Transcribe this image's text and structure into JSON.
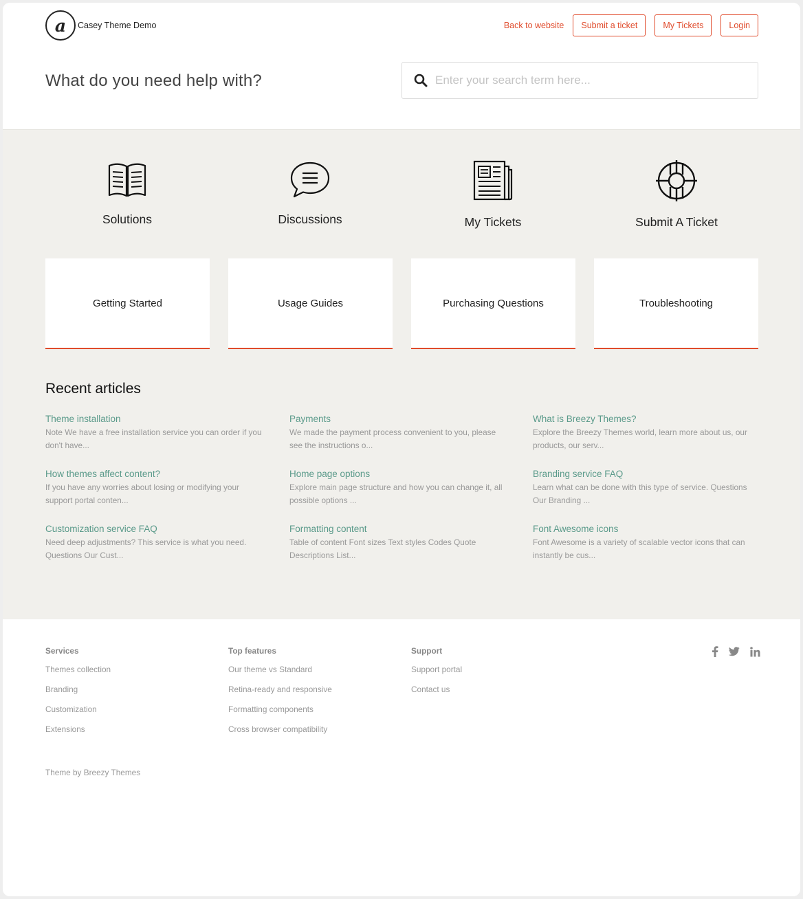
{
  "header": {
    "brand_mark": "a",
    "brand_name": "Casey Theme Demo",
    "nav": {
      "back_link": "Back to website",
      "submit_ticket": "Submit a ticket",
      "my_tickets": "My Tickets",
      "login": "Login"
    }
  },
  "hero": {
    "title": "What do you need help with?",
    "search_placeholder": "Enter your search term here..."
  },
  "quick_links": [
    {
      "label": "Solutions",
      "icon": "open-book-icon"
    },
    {
      "label": "Discussions",
      "icon": "speech-bubble-icon"
    },
    {
      "label": "My Tickets",
      "icon": "newspaper-icon"
    },
    {
      "label": "Submit A Ticket",
      "icon": "lifebuoy-icon"
    }
  ],
  "categories": [
    {
      "label": "Getting Started"
    },
    {
      "label": "Usage Guides"
    },
    {
      "label": "Purchasing Questions"
    },
    {
      "label": "Troubleshooting"
    }
  ],
  "recent": {
    "title": "Recent articles",
    "articles": [
      {
        "title": "Theme installation",
        "desc": "  Note We have a free installation service you can order if you don't have..."
      },
      {
        "title": "Payments",
        "desc": "We made the payment process convenient to you, please see the instructions o..."
      },
      {
        "title": "What is Breezy Themes?",
        "desc": "Explore the Breezy Themes world, learn more about us, our products, our serv..."
      },
      {
        "title": "How themes affect content?",
        "desc": "If you have any worries about losing or modifying your support portal conten..."
      },
      {
        "title": "Home page options",
        "desc": "Explore main page structure and how you can change it, all possible options ..."
      },
      {
        "title": "Branding service FAQ",
        "desc": "Learn what can be done with this type of service. Questions  Our Branding ..."
      },
      {
        "title": "Customization service FAQ",
        "desc": "Need deep adjustments? This service is what you need. Questions Our Cust..."
      },
      {
        "title": "Formatting content",
        "desc": "Table of content Font sizes Text styles Codes Quote Descriptions List..."
      },
      {
        "title": "Font Awesome icons",
        "desc": "Font Awesome is a variety of scalable vector icons that can instantly be cus..."
      }
    ]
  },
  "footer": {
    "columns": [
      {
        "heading": "Services",
        "links": [
          "Themes collection",
          "Branding",
          "Customization",
          "Extensions"
        ]
      },
      {
        "heading": "Top features",
        "links": [
          "Our theme vs Standard",
          "Retina-ready and responsive",
          "Formatting components",
          "Cross browser compatibility"
        ]
      },
      {
        "heading": "Support",
        "links": [
          "Support portal",
          "Contact us"
        ]
      }
    ],
    "social": [
      "facebook-icon",
      "twitter-icon",
      "linkedin-icon"
    ],
    "credit": "Theme by Breezy Themes"
  },
  "colors": {
    "accent": "#e04b2c",
    "article_link": "#5a9a8a",
    "band_bg": "#f1f0ec"
  }
}
